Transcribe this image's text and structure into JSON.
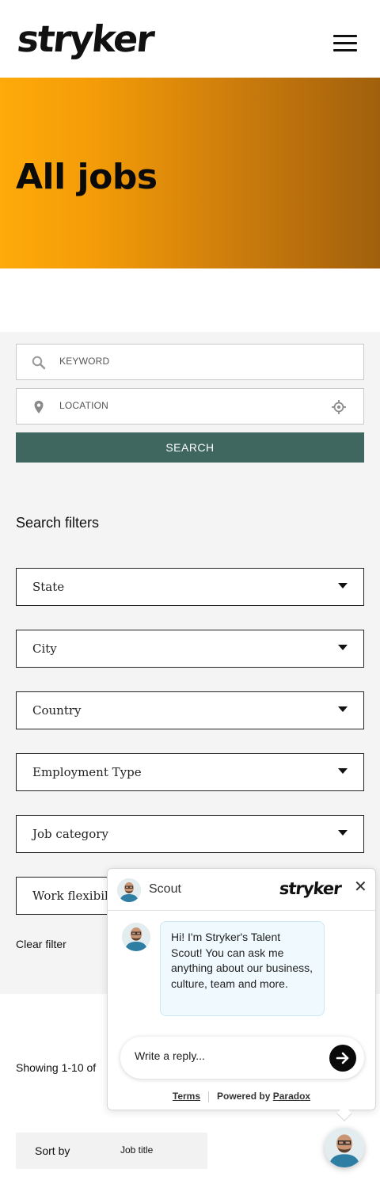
{
  "header": {
    "logo_text": "stryker",
    "menu_icon": "hamburger-menu-icon"
  },
  "hero": {
    "title": "All jobs",
    "gradient_colors": [
      "#ffaa0b",
      "#a1600d"
    ]
  },
  "search": {
    "keyword_placeholder": "KEYWORD",
    "location_placeholder": "LOCATION",
    "button_label": "SEARCH",
    "button_color": "#3f6760"
  },
  "filters": {
    "title": "Search filters",
    "items": [
      "State",
      "City",
      "Country",
      "Employment Type",
      "Job category",
      "Work flexibility"
    ],
    "clear_label": "Clear filter"
  },
  "results": {
    "showing_text": "Showing 1-10 of",
    "sort_label": "Sort by",
    "sort_value": "Job title"
  },
  "chat": {
    "agent_name": "Scout",
    "brand_logo": "stryker",
    "message": "Hi! I'm Stryker's Talent Scout! You can ask me anything about our business, culture, team and more.",
    "reply_placeholder": "Write a reply...",
    "terms_label": "Terms",
    "powered_by": "Powered by",
    "powered_brand": "Paradox"
  }
}
